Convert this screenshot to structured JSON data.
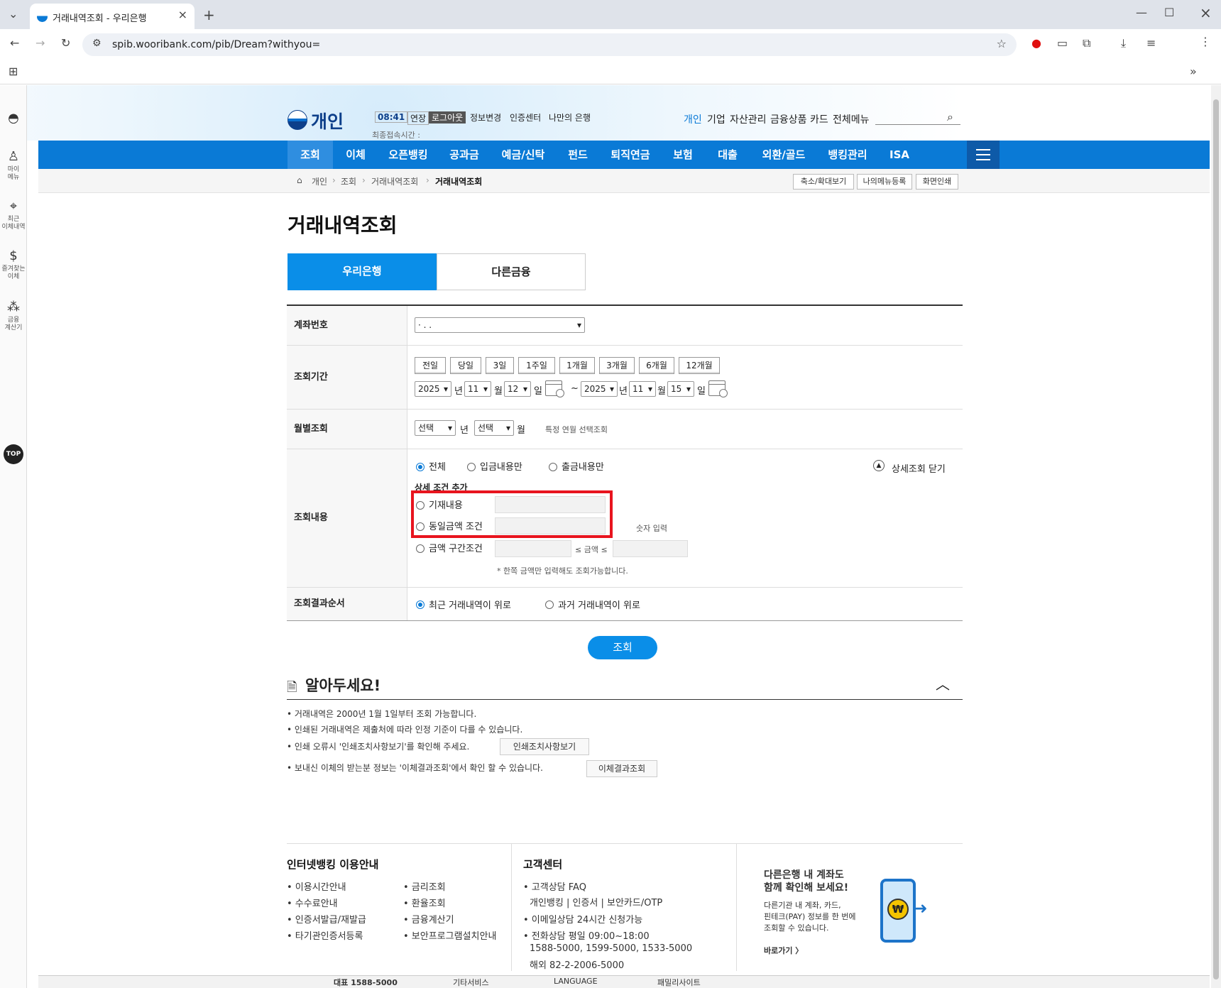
{
  "browser": {
    "tab_title": "거래내역조회 - 우리은행",
    "url": "spib.wooribank.com/pib/Dream?withyou="
  },
  "rail": {
    "items": [
      {
        "label": "마이\n메뉴"
      },
      {
        "label": "최근\n이체내역"
      },
      {
        "label": "즐겨찾는\n이체"
      },
      {
        "label": "금융\n계산기"
      }
    ],
    "top": "TOP"
  },
  "header": {
    "logo_text": "개인",
    "session_time": "08:41",
    "extend": "연장",
    "logout": "로그아웃",
    "links": [
      "정보변경",
      "인증센터",
      "나만의 은행"
    ],
    "last_login": "최종접속시간 :",
    "topnav": [
      "개인",
      "기업",
      "자산관리",
      "금융상품",
      "카드",
      "전체메뉴"
    ]
  },
  "gnb": [
    "조회",
    "이체",
    "오픈뱅킹",
    "공과금",
    "예금/신탁",
    "펀드",
    "퇴직연금",
    "보험",
    "대출",
    "외환/골드",
    "뱅킹관리",
    "ISA"
  ],
  "breadcrumb": [
    "개인",
    "조회",
    "거래내역조회",
    "거래내역조회"
  ],
  "util_buttons": [
    "축소/확대보기",
    "나의메뉴등록",
    "화면인쇄"
  ],
  "page_title": "거래내역조회",
  "tabs": [
    "우리은행",
    "다른금융"
  ],
  "form": {
    "account_label": "계좌번호",
    "account_value": "·                          .                   .",
    "period_label": "조회기간",
    "period_buttons": [
      "전일",
      "당일",
      "3일",
      "1주일",
      "1개월",
      "3개월",
      "6개월",
      "12개월"
    ],
    "from": {
      "year": "2025",
      "month": "11",
      "day": "12"
    },
    "to": {
      "year": "2025",
      "month": "11",
      "day": "15"
    },
    "unit_year": "년",
    "unit_month": "월",
    "unit_day": "일",
    "tilde": "~",
    "monthly_label": "월별조회",
    "monthly_year": "선택",
    "monthly_month": "선택",
    "monthly_hint": "특정 연월 선택조회",
    "content_label": "조회내용",
    "content_options": [
      "전체",
      "입금내용만",
      "출금내용만"
    ],
    "detail_toggle": "상세조회 닫기",
    "detail_title": "상세 조건 추가",
    "detail_memo": "기재내용",
    "detail_same_amount": "동일금액 조건",
    "numeric_hint": "숫자 입력",
    "detail_range": "금액 구간조건",
    "range_mid": "≤ 금액 ≤",
    "range_note": "* 한쪽 금액만 입력해도 조회가능합니다.",
    "order_label": "조회결과순서",
    "order_options": [
      "최근 거래내역이 위로",
      "과거 거래내역이 위로"
    ]
  },
  "submit": "조회",
  "notice": {
    "title": "알아두세요!",
    "items": [
      "• 거래내역은 2000년 1월 1일부터 조회 가능합니다.",
      "• 인쇄된 거래내역은 제출처에 따라 인정 기준이 다를 수 있습니다.",
      "• 인쇄 오류시 '인쇄조치사항보기'를 확인해 주세요.",
      "• 보내신 이체의 받는분 정보는 '이체결과조회'에서 확인 할 수 있습니다."
    ],
    "btn_print": "인쇄조치사항보기",
    "btn_result": "이체결과조회"
  },
  "footer": {
    "guide_title": "인터넷뱅킹 이용안내",
    "guide_col1": [
      "• 이용시간안내",
      "• 수수료안내",
      "• 인증서발급/재발급",
      "• 타기관인증서등록"
    ],
    "guide_col2": [
      "• 금리조회",
      "• 환율조회",
      "• 금융계산기",
      "• 보안프로그램설치안내"
    ],
    "cs_title": "고객센터",
    "cs_items": [
      "• 고객상담 FAQ",
      "개인뱅킹 | 인증서 | 보안카드/OTP",
      "• 이메일상담 24시간 신청가능",
      "• 전화상담 평일 09:00~18:00",
      "1588-5000, 1599-5000, 1533-5000",
      "해외 82-2-2006-5000"
    ],
    "promo_title1": "다른은행 내 계좌도",
    "promo_title2": "함께 확인해 보세요!",
    "promo_desc": [
      "다른기관 내 계좌, 카드,",
      "핀테크(PAY) 정보를 한 번에",
      "조회할 수 있습니다."
    ],
    "promo_link": "바로가기 〉",
    "bottom": [
      "대표 1588-5000",
      "기타서비스",
      "LANGUAGE",
      "패밀리사이트"
    ]
  }
}
